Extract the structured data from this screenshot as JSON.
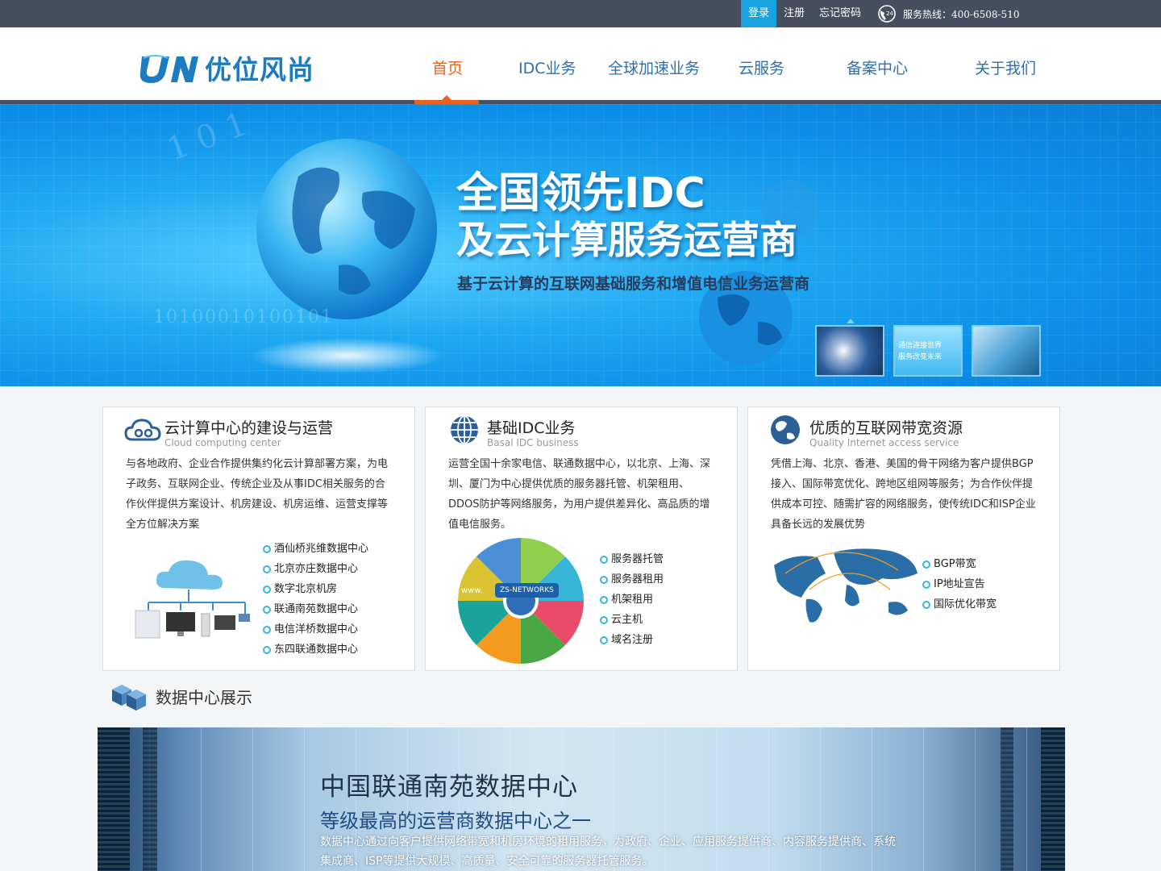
{
  "topbar": {
    "login": "登录",
    "register": "注册",
    "forgot": "忘记密码",
    "hotline": "服务热线：400-6508-510",
    "hotline_icon": "phone-24-icon"
  },
  "logo": {
    "mark": "UN",
    "brand": "优位风尚"
  },
  "nav": {
    "items": [
      {
        "label": "首页",
        "active": true
      },
      {
        "label": "IDC业务",
        "active": false
      },
      {
        "label": "全球加速业务",
        "active": false
      },
      {
        "label": "云服务",
        "active": false
      },
      {
        "label": "备案中心",
        "active": false
      },
      {
        "label": "关于我们",
        "active": false
      }
    ]
  },
  "banner": {
    "title1": "全国领先IDC",
    "title2": "及云计算服务运营商",
    "subtitle": "基于云计算的互联网基础服务和增值电信业务运营商",
    "binary1": "10100010100101",
    "binary2": "1 0 1",
    "thumbs": [
      {
        "caption": ""
      },
      {
        "caption": "通信连接世界\n服务改变未来"
      },
      {
        "caption": ""
      }
    ]
  },
  "cards": [
    {
      "title": "云计算中心的建设与运营",
      "subtitle": "Cloud computing center",
      "icon": "cloud-icon",
      "desc": "与各地政府、企业合作提供集约化云计算部署方案，为电子政务、互联网企业、传统企业及从事IDC相关服务的合作伙伴提供方案设计、机房建设、机房运维、运营支撑等全方位解决方案",
      "items": [
        "酒仙桥兆维数据中心",
        "北京亦庄数据中心",
        "数字北京机房",
        "联通南苑数据中心",
        "电信洋桥数据中心",
        "东四联通数据中心"
      ]
    },
    {
      "title": "基础IDC业务",
      "subtitle": "Basal IDC business",
      "icon": "globe-grid-icon",
      "desc": "运营全国十余家电信、联通数据中心，以北京、上海、深圳、厦门为中心提供优质的服务器托管、机架租用、DDOS防护等网络服务，为用户提供差异化、高品质的增值电信服务。",
      "items": [
        "服务器托管",
        "服务器租用",
        "机架租用",
        "云主机",
        "域名注册"
      ],
      "graphic_label": "ZS-NETWORKS",
      "graphic_www": "www."
    },
    {
      "title": "优质的互联网带宽资源",
      "subtitle": "Quality Internet access service",
      "icon": "globe-icon",
      "desc": "凭借上海、北京、香港、美国的骨干网络为客户提供BGP接入、国际带宽优化、跨地区组网等服务；为合作伙伴提供成本可控、随需扩容的网络服务，使传统IDC和ISP企业具备长远的发展优势",
      "items": [
        "BGP带宽",
        "IP地址宣告",
        "国际优化带宽"
      ]
    }
  ],
  "section": {
    "title": "数据中心展示",
    "icon": "server-cubes-icon"
  },
  "showcase": {
    "title": "中国联通南苑数据中心",
    "subtitle": "等级最高的运营商数据中心之一",
    "desc": "数据中心通过向客户提供网络带宽和机房环境的租用服务，为政府、企业、应用服务提供商、内容服务提供商、系统集成商、ISP等提供大规模、高质量、安全可靠的服务器托管服务。"
  },
  "colors": {
    "accent": "#19a3e0",
    "nav_active": "#e7621d",
    "nav": "#2f6fae",
    "topbar": "#474e60"
  }
}
